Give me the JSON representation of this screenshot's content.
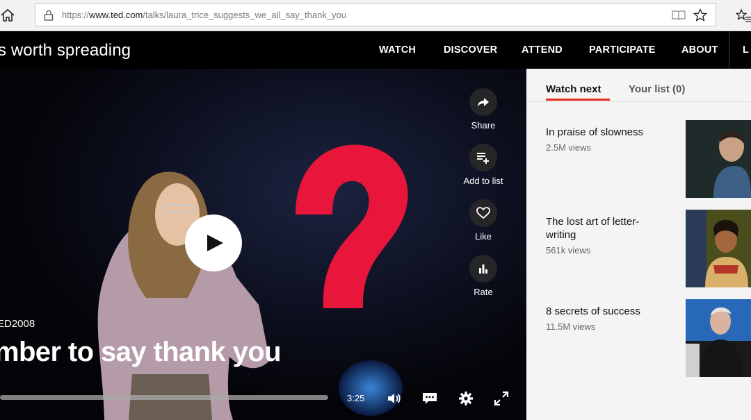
{
  "browser": {
    "url_prefix": "https://",
    "url_host": "www.ted.com",
    "url_path": "/talks/laura_trice_suggests_we_all_say_thank_you"
  },
  "nav": {
    "tagline": "s worth spreading",
    "links": [
      "WATCH",
      "DISCOVER",
      "ATTEND",
      "PARTICIPATE",
      "ABOUT"
    ],
    "login_partial": "L"
  },
  "video": {
    "event": "ED2008",
    "title": "mber to say thank you",
    "time": "3:25",
    "progress": 1.0,
    "actions": [
      {
        "label": "Share",
        "icon": "share-icon"
      },
      {
        "label": "Add to list",
        "icon": "playlist-add-icon"
      },
      {
        "label": "Like",
        "icon": "heart-icon"
      },
      {
        "label": "Rate",
        "icon": "bar-chart-icon"
      }
    ],
    "colors": {
      "question_mark": "#e8163a",
      "background": "#07070f"
    }
  },
  "panel": {
    "tabs": [
      "Watch next",
      "Your list (0)"
    ],
    "active_tab": "Watch next",
    "items": [
      {
        "title": "In praise of slowness",
        "views": "2.5M views"
      },
      {
        "title": "The lost art of letter-writing",
        "views": "561k views"
      },
      {
        "title": "8 secrets of success",
        "views": "11.5M views"
      }
    ]
  },
  "colors": {
    "accent": "#e62b1e"
  }
}
